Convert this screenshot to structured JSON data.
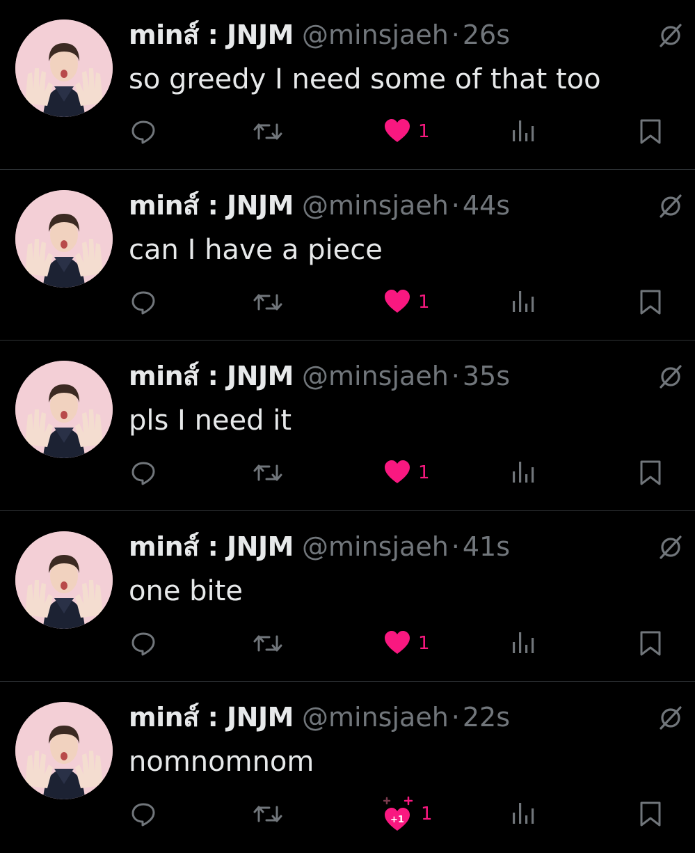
{
  "feed": {
    "tweets": [
      {
        "display_name": "minส์ : JNJM",
        "handle": "@minsjaeh",
        "separator": "·",
        "time": "26s",
        "text": "so greedy I need some of that too",
        "like_count": "1",
        "liked": true
      },
      {
        "display_name": "minส์ : JNJM",
        "handle": "@minsjaeh",
        "separator": "·",
        "time": "44s",
        "text": "can I have a piece",
        "like_count": "1",
        "liked": true
      },
      {
        "display_name": "minส์ : JNJM",
        "handle": "@minsjaeh",
        "separator": "·",
        "time": "35s",
        "text": "pls I need it",
        "like_count": "1",
        "liked": true
      },
      {
        "display_name": "minส์ : JNJM",
        "handle": "@minsjaeh",
        "separator": "·",
        "time": "41s",
        "text": "one bite",
        "like_count": "1",
        "liked": true
      },
      {
        "display_name": "minส์ : JNJM",
        "handle": "@minsjaeh",
        "separator": "·",
        "time": "22s",
        "text": "nomnomnom",
        "like_count": "1",
        "liked": true,
        "like_badge": "+1"
      }
    ]
  },
  "icons": {
    "reply": "reply-icon",
    "retweet": "retweet-icon",
    "like": "heart-icon",
    "views": "views-icon",
    "bookmark": "bookmark-icon",
    "mute": "muted-icon"
  },
  "colors": {
    "background": "#000000",
    "text": "#e7e9ea",
    "secondary": "#71767b",
    "like": "#f91880",
    "divider": "#2f3336",
    "avatar_bg": "#f3cfd6"
  }
}
